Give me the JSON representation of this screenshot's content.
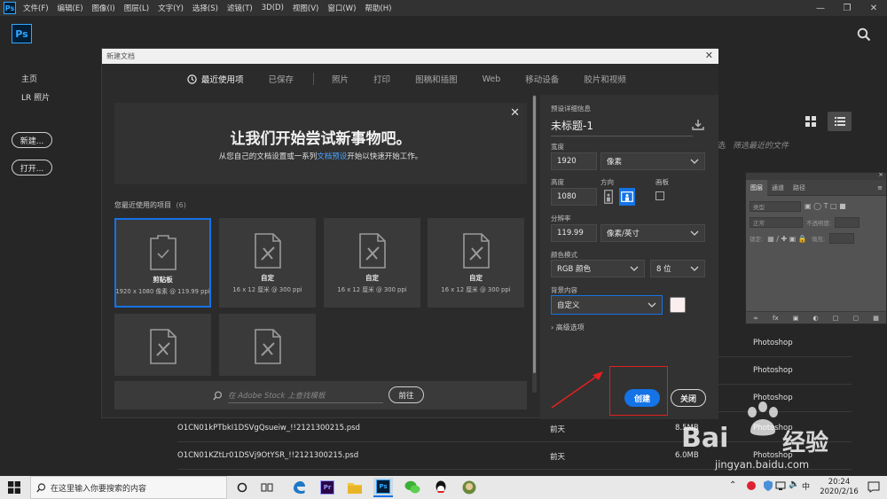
{
  "menubar": {
    "items": [
      "文件(F)",
      "编辑(E)",
      "图像(I)",
      "图层(L)",
      "文字(Y)",
      "选择(S)",
      "滤镜(T)",
      "3D(D)",
      "视图(V)",
      "窗口(W)",
      "帮助(H)"
    ]
  },
  "home": {
    "logo": "Ps",
    "sidebar": {
      "home": "主页",
      "lr_photos": "LR 照片"
    },
    "new_button": "新建...",
    "open_button": "打开...",
    "filter_text": "选",
    "filter_hint": "筛选最近的文件",
    "files": [
      {
        "name": "",
        "when": "",
        "size": "",
        "type": "Photoshop"
      },
      {
        "name": "",
        "when": "",
        "size": "",
        "type": "Photoshop"
      },
      {
        "name": "",
        "when": "",
        "size": "",
        "type": "Photoshop"
      },
      {
        "name": "O1CN01kPTbkI1DSVgQsueiw_!!2121300215.psd",
        "when": "前天",
        "size": "8.5MB",
        "type": "Photoshop"
      },
      {
        "name": "O1CN01KZtLr01DSVj9OtYSR_!!2121300215.psd",
        "when": "前天",
        "size": "6.0MB",
        "type": "Photoshop"
      }
    ]
  },
  "layers_panel": {
    "tabs": [
      "图层",
      "通道",
      "路径"
    ],
    "kind_placeholder": "类型",
    "blend_mode": "正常",
    "opacity_label": "不透明度:",
    "lock_label": "锁定:",
    "fill_label": "填充:"
  },
  "dialog": {
    "title": "新建文档",
    "tabs": [
      "最近使用项",
      "已保存",
      "照片",
      "打印",
      "图稿和插图",
      "Web",
      "移动设备",
      "胶片和视频"
    ],
    "banner_heading": "让我们开始尝试新事物吧。",
    "banner_sub_prefix": "从您自己的文档设置或一系列",
    "banner_sub_link": "文档预设",
    "banner_sub_suffix": "开始以快速开始工作。",
    "recent_label": "您最近使用的项目",
    "recent_count": "(6)",
    "presets": [
      {
        "name": "剪贴板",
        "size": "1920 x 1080 像素 @ 119.99 ppi",
        "icon": "clipboard-icon",
        "selected": true
      },
      {
        "name": "自定",
        "size": "16 x 12 厘米 @ 300 ppi",
        "icon": "document-icon",
        "selected": false
      },
      {
        "name": "自定",
        "size": "16 x 12 厘米 @ 300 ppi",
        "icon": "document-icon",
        "selected": false
      },
      {
        "name": "自定",
        "size": "16 x 12 厘米 @ 300 ppi",
        "icon": "document-icon",
        "selected": false
      },
      {
        "name": "",
        "size": "",
        "icon": "document-icon",
        "selected": false
      },
      {
        "name": "",
        "size": "",
        "icon": "document-icon",
        "selected": false
      }
    ],
    "stock_placeholder": "在 Adobe Stock 上查找模板",
    "go_button": "前往",
    "details": {
      "header": "预设详细信息",
      "doc_name": "未标题-1",
      "width_label": "宽度",
      "width_value": "1920",
      "width_unit": "像素",
      "height_label": "高度",
      "height_value": "1080",
      "orientation_label": "方向",
      "artboard_label": "画板",
      "resolution_label": "分辨率",
      "resolution_value": "119.99",
      "resolution_unit": "像素/英寸",
      "color_mode_label": "颜色模式",
      "color_mode_value": "RGB 颜色",
      "bit_depth": "8 位",
      "background_label": "背景内容",
      "background_value": "自定义",
      "advanced": "高级选项",
      "create_button": "创建",
      "close_button": "关闭"
    }
  },
  "taskbar": {
    "search_placeholder": "在这里输入你要搜索的内容",
    "ime": "中",
    "time": "20:24",
    "date": "2020/2/16"
  },
  "watermark": {
    "brand": "Bai",
    "brand_cn": "经验",
    "url": "jingyan.baidu.com"
  },
  "colors": {
    "accent": "#1473e6",
    "highlight": "#e02020",
    "bg": "#262626"
  }
}
